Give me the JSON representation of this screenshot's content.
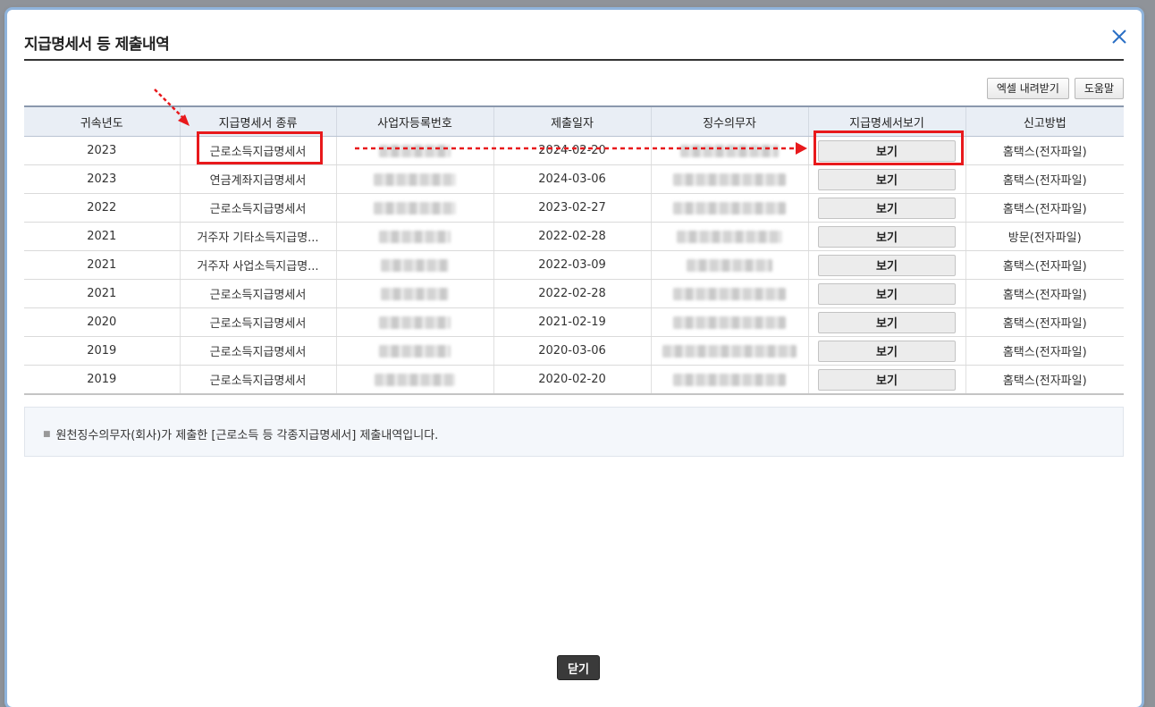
{
  "dialog": {
    "title": "지급명세서 등 제출내역",
    "close_icon": "close-x-icon"
  },
  "toolbar": {
    "excel_label": "엑셀 내려받기",
    "help_label": "도움말"
  },
  "table": {
    "headers": [
      "귀속년도",
      "지급명세서 종류",
      "사업자등록번호",
      "제출일자",
      "징수의무자",
      "지급명세서보기",
      "신고방법"
    ],
    "view_label": "보기",
    "rows": [
      {
        "year": "2023",
        "type": "근로소득지급명세서",
        "date": "2024-02-20",
        "method": "홈택스(전자파일)"
      },
      {
        "year": "2023",
        "type": "연금계좌지급명세서",
        "date": "2024-03-06",
        "method": "홈택스(전자파일)"
      },
      {
        "year": "2022",
        "type": "근로소득지급명세서",
        "date": "2023-02-27",
        "method": "홈택스(전자파일)"
      },
      {
        "year": "2021",
        "type": "거주자 기타소득지급명...",
        "date": "2022-02-28",
        "method": "방문(전자파일)"
      },
      {
        "year": "2021",
        "type": "거주자 사업소득지급명...",
        "date": "2022-03-09",
        "method": "홈택스(전자파일)"
      },
      {
        "year": "2021",
        "type": "근로소득지급명세서",
        "date": "2022-02-28",
        "method": "홈택스(전자파일)"
      },
      {
        "year": "2020",
        "type": "근로소득지급명세서",
        "date": "2021-02-19",
        "method": "홈택스(전자파일)"
      },
      {
        "year": "2019",
        "type": "근로소득지급명세서",
        "date": "2020-03-06",
        "method": "홈택스(전자파일)"
      },
      {
        "year": "2019",
        "type": "근로소득지급명세서",
        "date": "2020-02-20",
        "method": "홈택스(전자파일)"
      }
    ]
  },
  "notice": {
    "text": "원천징수의무자(회사)가 제출한 [근로소득 등 각종지급명세서] 제출내역입니다."
  },
  "footer": {
    "close_label": "닫기"
  },
  "colors": {
    "annotation": "#e8191c",
    "header_bg": "#e9eef5"
  }
}
